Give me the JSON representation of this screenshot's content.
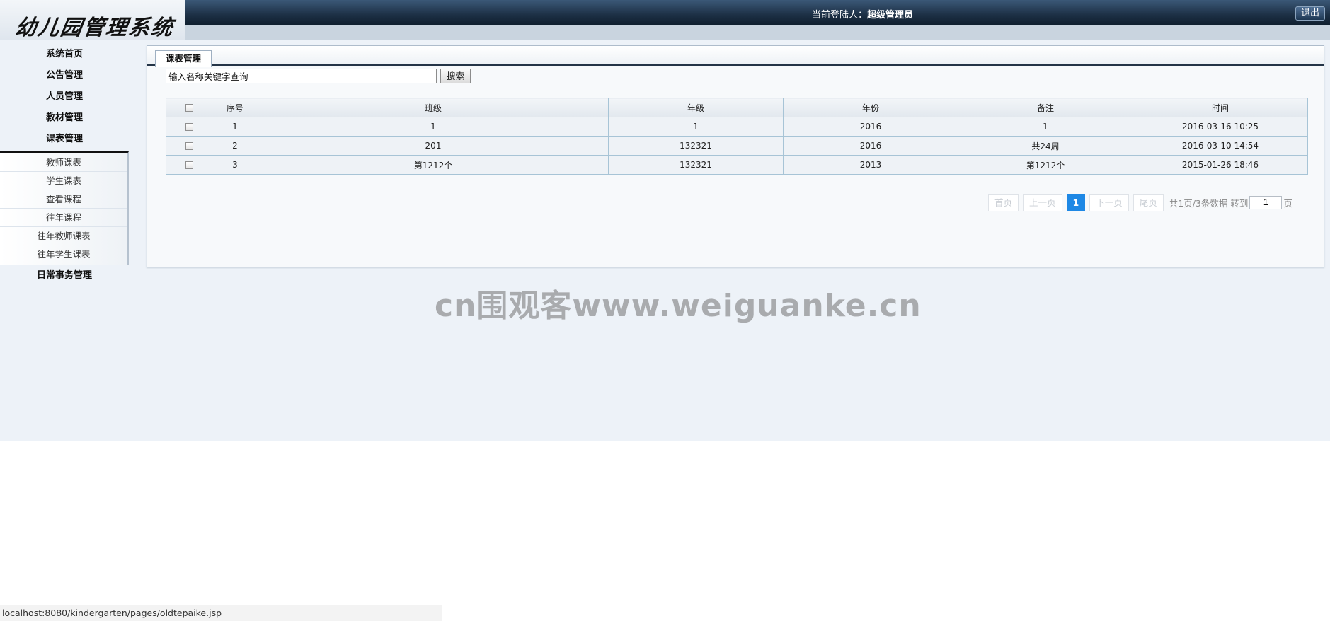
{
  "header": {
    "logo_text": "幼儿园管理系统",
    "login_label": "当前登陆人：",
    "login_user": "超级管理员",
    "logout_label": "退出"
  },
  "sidebar": {
    "items": [
      {
        "label": "系统首页"
      },
      {
        "label": "公告管理"
      },
      {
        "label": "人员管理"
      },
      {
        "label": "教材管理"
      },
      {
        "label": "课表管理"
      }
    ],
    "submenu": [
      {
        "label": "教师课表"
      },
      {
        "label": "学生课表"
      },
      {
        "label": "查看课程"
      },
      {
        "label": "往年课程"
      },
      {
        "label": "往年教师课表"
      },
      {
        "label": "往年学生课表"
      }
    ],
    "last_item": {
      "label": "日常事务管理"
    }
  },
  "panel": {
    "tab_label": "课表管理",
    "search": {
      "value": "输入名称关键字查询",
      "button_label": "搜索"
    },
    "table": {
      "columns": [
        "序号",
        "班级",
        "年级",
        "年份",
        "备注",
        "时间"
      ],
      "rows": [
        [
          "1",
          "1",
          "1",
          "2016",
          "1",
          "2016-03-16 10:25"
        ],
        [
          "2",
          "201",
          "132321",
          "2016",
          "共24周",
          "2016-03-10 14:54"
        ],
        [
          "3",
          "第1212个",
          "132321",
          "2013",
          "第1212个",
          "2015-01-26 18:46"
        ]
      ]
    },
    "pager": {
      "first": "首页",
      "prev": "上一页",
      "current": "1",
      "next": "下一页",
      "last": "尾页",
      "info": "共1页/3条数据 转到",
      "goto_value": "1",
      "page_suffix": "页"
    }
  },
  "watermark": "cn围观客www.weiguanke.cn",
  "statusbar": {
    "url": "localhost:8080/kindergarten/pages/oldtepaike.jsp"
  }
}
